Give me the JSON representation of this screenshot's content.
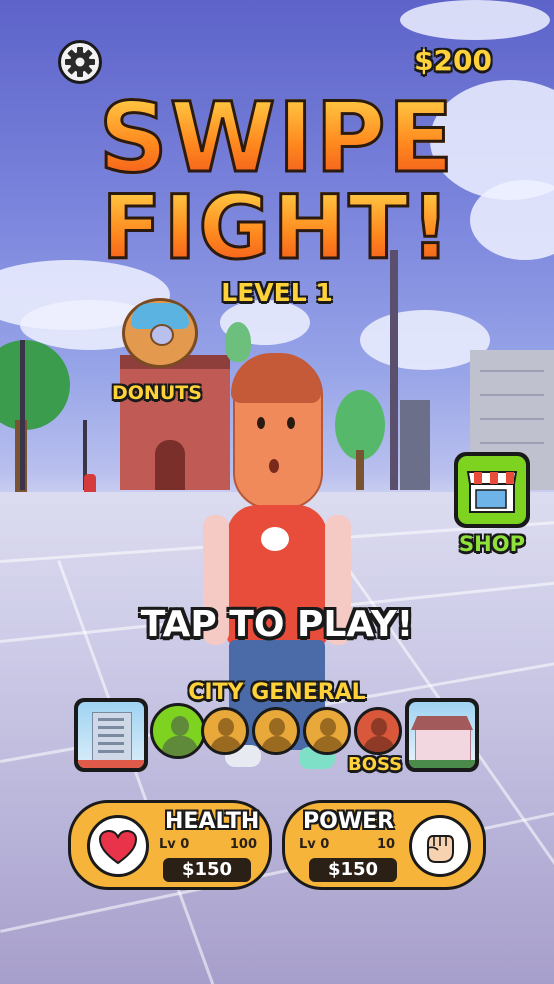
{
  "hud": {
    "money": "$200",
    "settings_icon": "gear-icon"
  },
  "title": {
    "line1": "SWIPE",
    "line2": "FIGHT!",
    "level": "LEVEL 1"
  },
  "scene": {
    "shop_sign": "DONUTS"
  },
  "shop": {
    "label": "SHOP",
    "icon": "shop-icon"
  },
  "prompt": "TAP TO PLAY!",
  "stage": {
    "name": "CITY GENERAL",
    "boss_label": "BOSS",
    "opponents_total": 5,
    "current_index": 0
  },
  "upgrades": {
    "health": {
      "title": "HEALTH",
      "level": "Lv 0",
      "value": "100",
      "price": "$150",
      "icon": "heart-icon"
    },
    "power": {
      "title": "POWER",
      "level": "Lv 0",
      "value": "10",
      "price": "$150",
      "icon": "fist-icon"
    }
  },
  "colors": {
    "accent_yellow": "#ffd23a",
    "button_green": "#7ed321",
    "card_orange": "#f6b53a",
    "boss_red": "#d9573a"
  }
}
